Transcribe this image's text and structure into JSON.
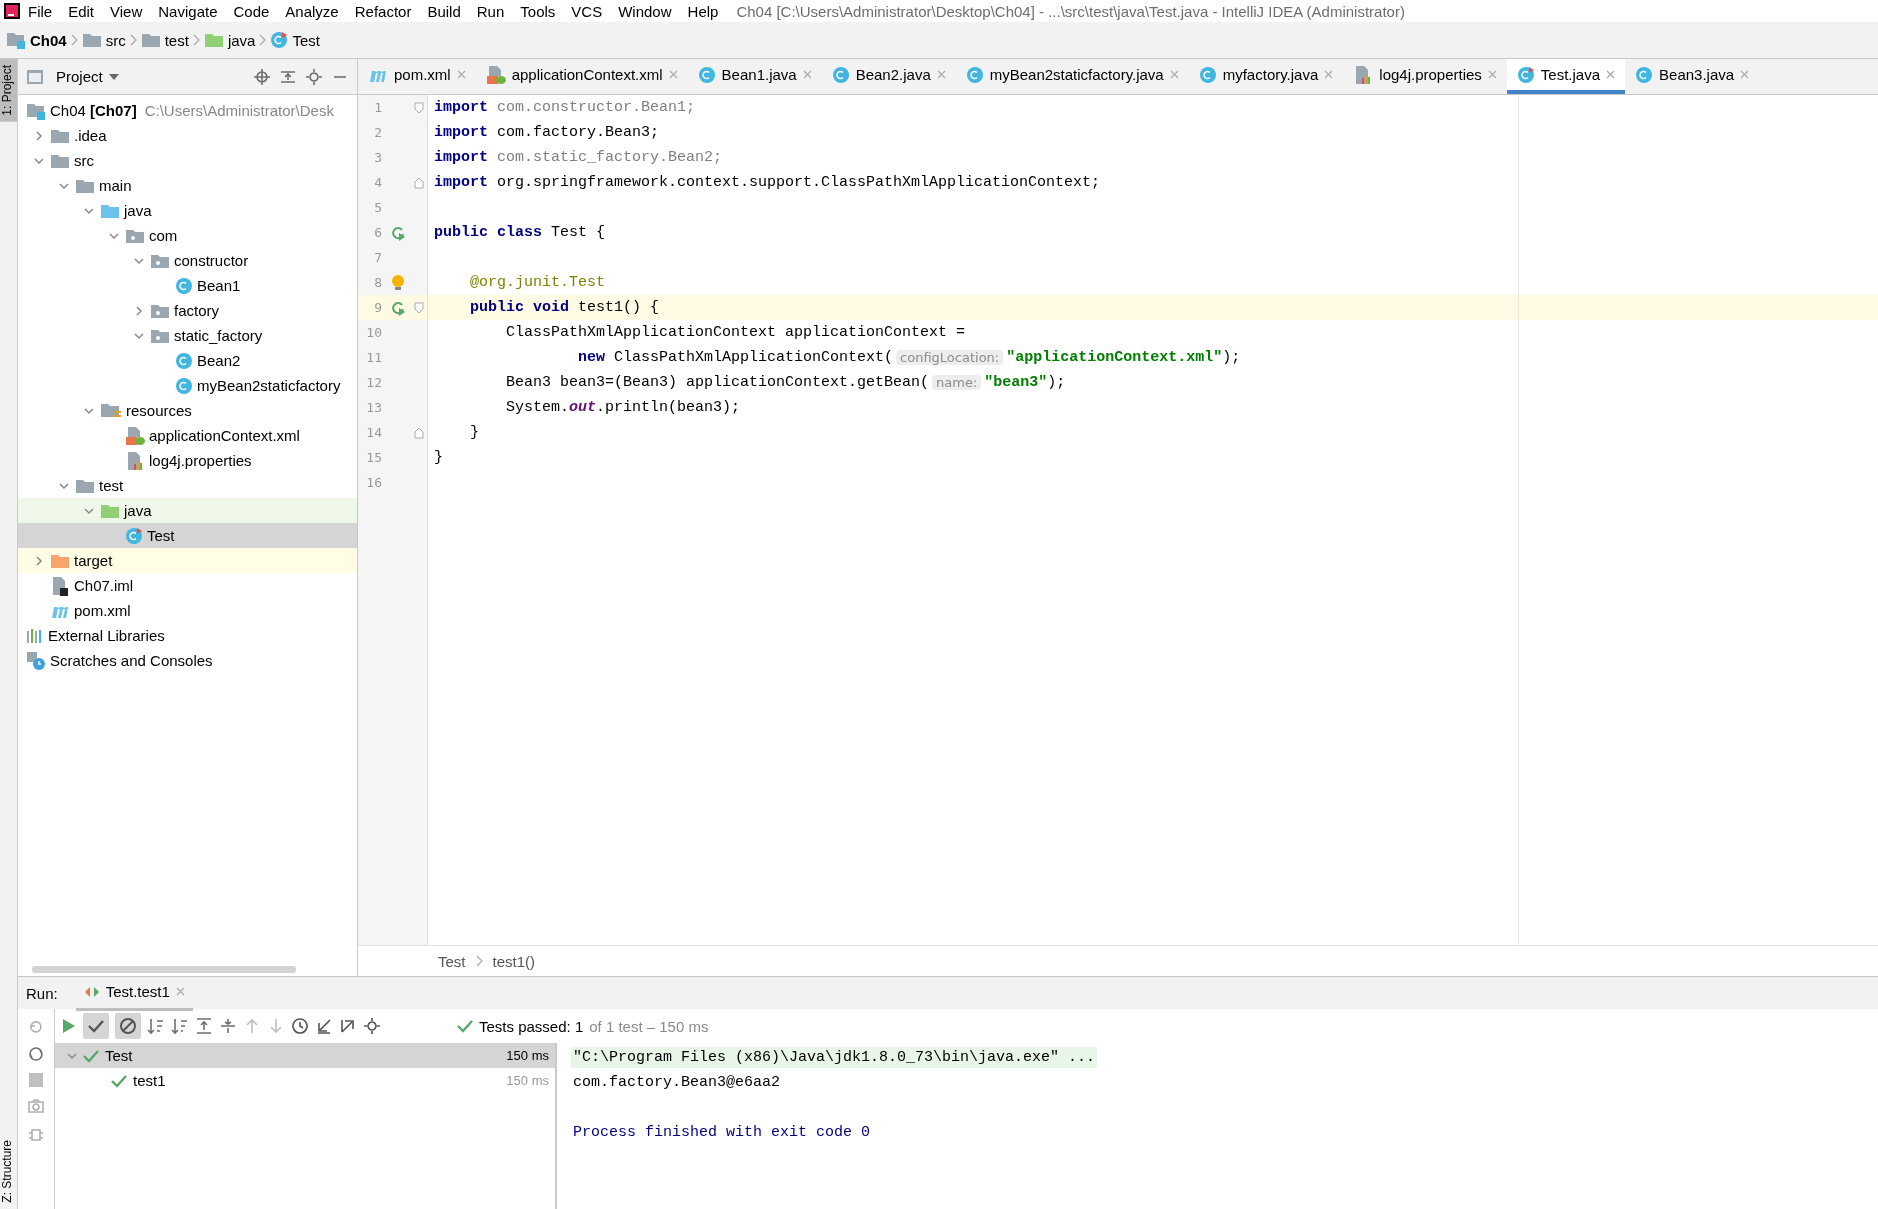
{
  "window": {
    "title": "Ch04 [C:\\Users\\Administrator\\Desktop\\Ch04] - ...\\src\\test\\java\\Test.java - IntelliJ IDEA (Administrator)"
  },
  "menu": [
    "File",
    "Edit",
    "View",
    "Navigate",
    "Code",
    "Analyze",
    "Refactor",
    "Build",
    "Run",
    "Tools",
    "VCS",
    "Window",
    "Help"
  ],
  "navigation_bar": [
    {
      "kind": "module",
      "label": "Ch04"
    },
    {
      "kind": "folder",
      "label": "src"
    },
    {
      "kind": "folder",
      "label": "test"
    },
    {
      "kind": "test-folder",
      "label": "java"
    },
    {
      "kind": "test-class",
      "label": "Test"
    }
  ],
  "side_strip": {
    "top": "1: Project",
    "bottom": "Z: Structure"
  },
  "project_panel": {
    "title": "Project",
    "tree": [
      {
        "kind": "module",
        "label": "Ch04 **[Ch07]**",
        "path": "C:\\Users\\Administrator\\Desk",
        "selected": false,
        "children": [
          {
            "kind": "folder",
            "label": ".idea",
            "expanded": false,
            "selected": false
          },
          {
            "kind": "folder",
            "label": "src",
            "expanded": true,
            "selected": false,
            "children": [
              {
                "kind": "folder",
                "label": "main",
                "expanded": true,
                "selected": false,
                "children": [
                  {
                    "kind": "source-folder",
                    "label": "java",
                    "expanded": true,
                    "selected": false,
                    "children": [
                      {
                        "kind": "package",
                        "label": "com",
                        "expanded": true,
                        "selected": false,
                        "children": [
                          {
                            "kind": "package",
                            "label": "constructor",
                            "expanded": true,
                            "selected": false,
                            "children": [
                              {
                                "kind": "class",
                                "label": "Bean1",
                                "selected": false
                              }
                            ]
                          },
                          {
                            "kind": "package",
                            "label": "factory",
                            "expanded": false,
                            "selected": false
                          },
                          {
                            "kind": "package",
                            "label": "static_factory",
                            "expanded": true,
                            "selected": false,
                            "children": [
                              {
                                "kind": "class",
                                "label": "Bean2",
                                "selected": false
                              },
                              {
                                "kind": "class",
                                "label": "myBean2staticfactory",
                                "selected": false
                              }
                            ]
                          }
                        ]
                      }
                    ]
                  },
                  {
                    "kind": "resources",
                    "label": "resources",
                    "expanded": true,
                    "selected": false,
                    "children": [
                      {
                        "kind": "xml",
                        "label": "applicationContext.xml",
                        "selected": false
                      },
                      {
                        "kind": "properties",
                        "label": "log4j.properties",
                        "selected": false
                      }
                    ]
                  }
                ]
              },
              {
                "kind": "folder",
                "label": "test",
                "expanded": true,
                "selected": false,
                "children": [
                  {
                    "kind": "test-folder",
                    "label": "java",
                    "expanded": true,
                    "selected": false,
                    "children": [
                      {
                        "kind": "test-class",
                        "label": "Test",
                        "selected": true
                      }
                    ]
                  }
                ]
              }
            ]
          },
          {
            "kind": "excluded",
            "label": "target",
            "expanded": false,
            "selected": false
          },
          {
            "kind": "iml",
            "label": "Ch07.iml",
            "selected": false
          },
          {
            "kind": "maven",
            "label": "pom.xml",
            "selected": false
          }
        ]
      },
      {
        "kind": "libraries",
        "label": "External Libraries",
        "selected": false
      },
      {
        "kind": "scratches",
        "label": "Scratches and Consoles",
        "selected": false
      }
    ]
  },
  "editor_tabs": [
    {
      "kind": "maven",
      "label": "pom.xml",
      "selected": false
    },
    {
      "kind": "xml",
      "label": "applicationContext.xml",
      "selected": false
    },
    {
      "kind": "class",
      "label": "Bean1.java",
      "selected": false
    },
    {
      "kind": "class",
      "label": "Bean2.java",
      "selected": false
    },
    {
      "kind": "class",
      "label": "myBean2staticfactory.java",
      "selected": false
    },
    {
      "kind": "class",
      "label": "myfactory.java",
      "selected": false
    },
    {
      "kind": "properties",
      "label": "log4j.properties",
      "selected": false
    },
    {
      "kind": "test-class",
      "label": "Test.java",
      "selected": true
    },
    {
      "kind": "class",
      "label": "Bean3.java",
      "selected": false
    }
  ],
  "code": {
    "lines": [
      {
        "number": "1",
        "current": false,
        "run": false,
        "bulb": false,
        "fold": true,
        "tokens": [
          {
            "kind": "keyword",
            "text": "import "
          },
          {
            "kind": "unused",
            "text": "com.constructor.Bean1;"
          }
        ]
      },
      {
        "number": "2",
        "current": false,
        "run": false,
        "bulb": false,
        "fold": false,
        "tokens": [
          {
            "kind": "keyword",
            "text": "import "
          },
          {
            "kind": "plain",
            "text": "com.factory.Bean3;"
          }
        ]
      },
      {
        "number": "3",
        "current": false,
        "run": false,
        "bulb": false,
        "fold": false,
        "tokens": [
          {
            "kind": "keyword",
            "text": "import "
          },
          {
            "kind": "unused",
            "text": "com.static_factory.Bean2;"
          }
        ]
      },
      {
        "number": "4",
        "current": false,
        "run": false,
        "bulb": false,
        "fold": true,
        "tokens": [
          {
            "kind": "keyword",
            "text": "import "
          },
          {
            "kind": "plain",
            "text": "org.springframework.context.support.ClassPathXmlApplicationContext;"
          }
        ]
      },
      {
        "number": "5",
        "current": false,
        "run": false,
        "bulb": false,
        "fold": false
      },
      {
        "number": "6",
        "current": false,
        "run": true,
        "bulb": false,
        "fold": false,
        "tokens": [
          {
            "kind": "keyword",
            "text": "public class "
          },
          {
            "kind": "plain",
            "text": "Test {"
          }
        ]
      },
      {
        "number": "7",
        "current": false,
        "run": false,
        "bulb": false,
        "fold": false
      },
      {
        "number": "8",
        "current": false,
        "run": false,
        "bulb": true,
        "fold": false,
        "tokens": [
          {
            "kind": "annotation",
            "text": "    @org.junit."
          },
          {
            "kind": "annotation-type",
            "text": "Test"
          }
        ]
      },
      {
        "number": "9",
        "current": true,
        "run": true,
        "bulb": false,
        "fold": true,
        "tokens": [
          {
            "kind": "keyword",
            "text": "    public void "
          },
          {
            "kind": "plain",
            "text": "test1() {"
          }
        ]
      },
      {
        "number": "10",
        "current": false,
        "run": false,
        "bulb": false,
        "fold": false,
        "tokens": [
          {
            "kind": "plain",
            "text": "        ClassPathXmlApplicationContext applicationContext ="
          }
        ]
      },
      {
        "number": "11",
        "current": false,
        "run": false,
        "bulb": false,
        "fold": false,
        "tokens": [
          {
            "kind": "keyword",
            "text": "                new "
          },
          {
            "kind": "plain",
            "text": "ClassPathXmlApplicationContext("
          },
          {
            "kind": "hint",
            "text": "configLocation:"
          },
          {
            "kind": "string",
            "text": "\"applicationContext.xml\""
          },
          {
            "kind": "plain",
            "text": ");"
          }
        ]
      },
      {
        "number": "12",
        "current": false,
        "run": false,
        "bulb": false,
        "fold": false,
        "tokens": [
          {
            "kind": "plain",
            "text": "        Bean3 bean3=(Bean3) applicationContext.getBean("
          },
          {
            "kind": "hint",
            "text": "name:"
          },
          {
            "kind": "string",
            "text": "\"bean3\""
          },
          {
            "kind": "plain",
            "text": ");"
          }
        ]
      },
      {
        "number": "13",
        "current": false,
        "run": false,
        "bulb": false,
        "fold": false,
        "tokens": [
          {
            "kind": "plain",
            "text": "        System."
          },
          {
            "kind": "static",
            "text": "out"
          },
          {
            "kind": "plain",
            "text": ".println(bean3);"
          }
        ]
      },
      {
        "number": "14",
        "current": false,
        "run": false,
        "bulb": false,
        "fold": true,
        "tokens": [
          {
            "kind": "plain",
            "text": "    }"
          }
        ]
      },
      {
        "number": "15",
        "current": false,
        "run": false,
        "bulb": false,
        "fold": false,
        "tokens": [
          {
            "kind": "plain",
            "text": "}"
          }
        ]
      },
      {
        "number": "16",
        "current": false,
        "run": false,
        "bulb": false,
        "fold": false
      }
    ]
  },
  "editor_breadcrumb": [
    "Test",
    "test1()"
  ],
  "run_panel": {
    "label": "Run:",
    "tab": "Test.test1",
    "status": "Tests passed: 1",
    "status_detail": "of 1 test – 150 ms",
    "tests": [
      {
        "label": "Test",
        "time": "150 ms",
        "passed": true,
        "expanded": true,
        "selected": true,
        "children": [
          {
            "label": "test1",
            "time": "150 ms",
            "passed": true,
            "selected": false
          }
        ]
      }
    ],
    "console": [
      {
        "kind": "command",
        "text": "\"C:\\Program Files (x86)\\Java\\jdk1.8.0_73\\bin\\java.exe\" ..."
      },
      {
        "kind": "output",
        "text": "com.factory.Bean3@e6aa2"
      },
      {
        "kind": "blank"
      },
      {
        "kind": "system",
        "text": "Process finished with exit code 0"
      }
    ]
  }
}
